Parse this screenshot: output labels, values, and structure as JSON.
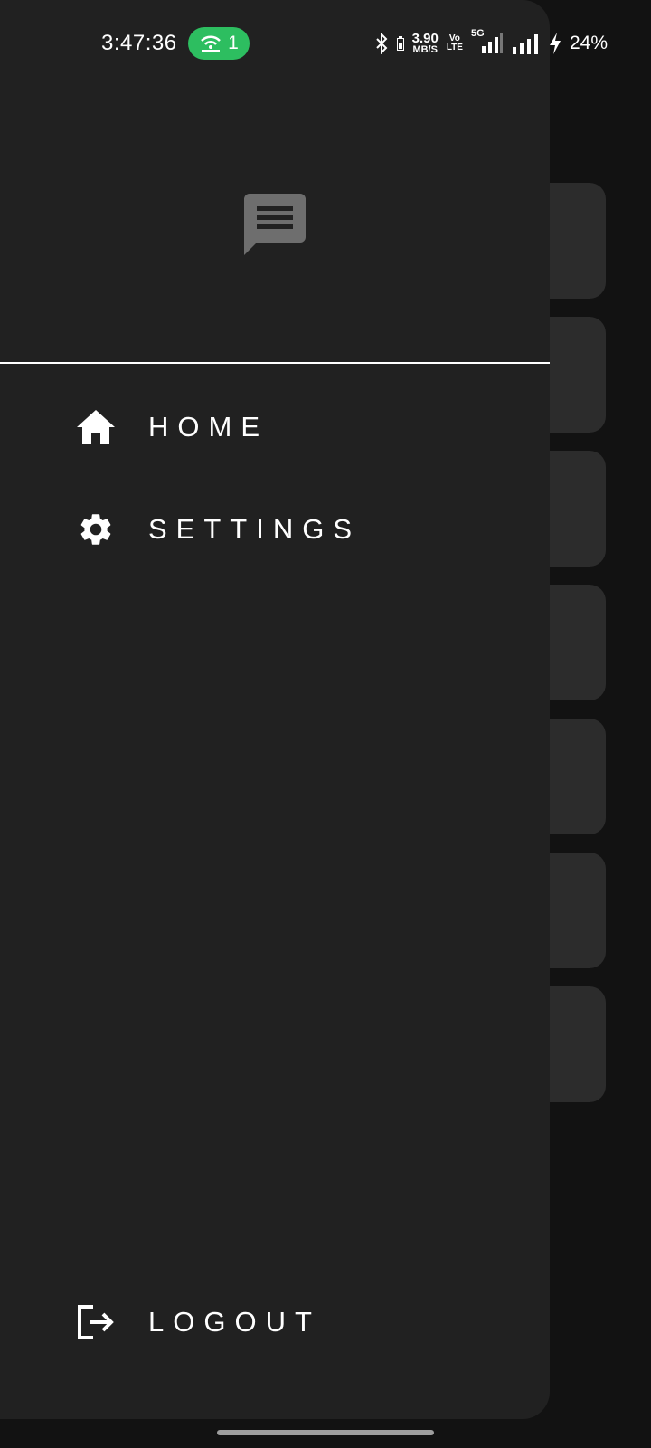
{
  "status_bar": {
    "time": "3:47:36",
    "hotspot_count": "1",
    "net_speed_value": "3.90",
    "net_speed_unit": "MB/S",
    "volte_top": "Vo",
    "volte_bottom": "LTE",
    "network_type": "5G",
    "battery": "24%"
  },
  "drawer": {
    "menu": [
      {
        "label": "HOME",
        "icon": "home-icon"
      },
      {
        "label": "SETTINGS",
        "icon": "gear-icon"
      }
    ],
    "logout": {
      "label": "LOGOUT",
      "icon": "logout-icon"
    }
  },
  "colors": {
    "drawer_bg": "#212121",
    "hotspot_pill": "#2dbe60",
    "background_card": "#2c2c2c"
  }
}
